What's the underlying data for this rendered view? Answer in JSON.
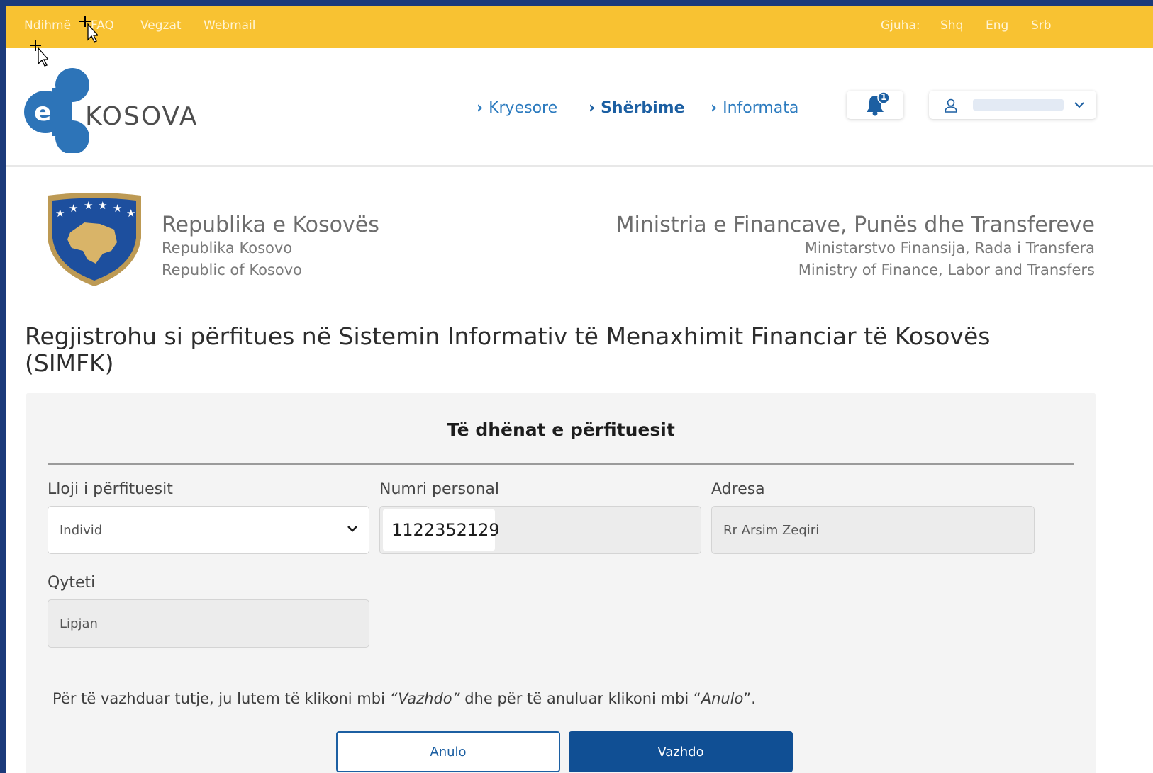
{
  "topbar": {
    "links": [
      "Ndihmë",
      "FAQ",
      "Vegzat",
      "Webmail"
    ],
    "language_label": "Gjuha:",
    "languages": [
      "Shq",
      "Eng",
      "Srb"
    ]
  },
  "header": {
    "logo_text": "KOSOVA",
    "nav": [
      "Kryesore",
      "Shërbime",
      "Informata"
    ],
    "active_nav": "Shërbime",
    "notification_count": "1"
  },
  "gov": {
    "title": "Republika e Kosovës",
    "subtitles": [
      "Republika Kosovo",
      "Republic of Kosovo"
    ]
  },
  "ministry": {
    "title": "Ministria e Financave, Punës dhe Transfereve",
    "subtitles": [
      "Ministarstvo Finansija, Rada i Transfera",
      "Ministry of Finance, Labor and Transfers"
    ]
  },
  "page_title": "Regjistrohu si përfitues në Sistemin Informativ të Menaxhimit Financiar të Kosovës (SIMFK)",
  "form": {
    "section_title": "Të dhënat e përfituesit",
    "beneficiary_type": {
      "label": "Lloji i përfituesit",
      "value": "Individ"
    },
    "personal_number": {
      "label": "Numri personal",
      "value": "1122352129"
    },
    "address": {
      "label": "Adresa",
      "value": "Rr Arsim Zeqiri"
    },
    "city": {
      "label": "Qyteti",
      "value": "Lipjan"
    },
    "instruction_prefix": "Për të vazhduar tutje, ju lutem të klikoni mbi ",
    "instruction_continue": "“Vazhdo”",
    "instruction_middle": " dhe për të anuluar klikoni mbi “",
    "instruction_cancel": "Anulo",
    "instruction_suffix": "”.",
    "cancel_label": "Anulo",
    "continue_label": "Vazhdo"
  },
  "colors": {
    "topbar": "#f8c232",
    "nav_link": "#2c7bbf",
    "primary_button": "#104f94",
    "logo_blue": "#2d74b8"
  }
}
